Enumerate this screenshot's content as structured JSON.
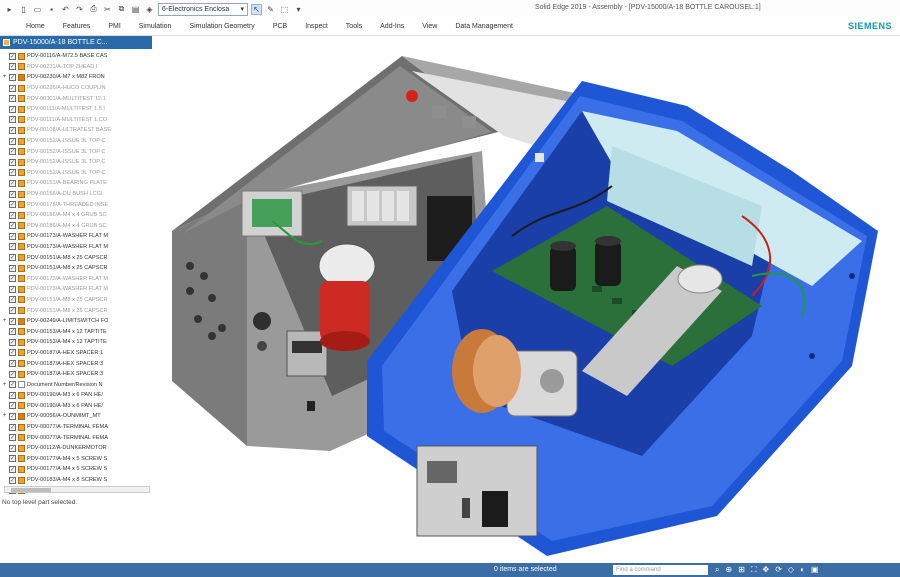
{
  "app": {
    "title": "Solid Edge 2019 - Assembly - [PDV-15000/A-18 BOTTLE CAROUSEL:1]",
    "brand": "SIEMENS",
    "doc_combo": "6-Electronics Enclosa"
  },
  "ribbon": {
    "tabs": [
      "Home",
      "Features",
      "PMI",
      "Simulation",
      "Simulation Geometry",
      "PCB",
      "Inspect",
      "Tools",
      "Add-Ins",
      "View",
      "Data Management"
    ]
  },
  "panel": {
    "title": "PDV-15000/A-18 BOTTLE C..."
  },
  "tree": [
    {
      "label": "PDV-00116/A-M72.5 BASE CAS",
      "dim": false,
      "exp": "",
      "icon": "part"
    },
    {
      "label": "PDV-00231/A-TOP 2HEAD I",
      "dim": true,
      "exp": "",
      "icon": "part"
    },
    {
      "label": "PDV-00230/A-M7 x M82 FRON",
      "dim": false,
      "exp": "+",
      "icon": "asm"
    },
    {
      "label": "PDV-00226/A-HUCO COUPLIN",
      "dim": true,
      "exp": "",
      "icon": "part"
    },
    {
      "label": "PDV-00301/A-MULTITEST 12.1",
      "dim": true,
      "exp": "",
      "icon": "part"
    },
    {
      "label": "PDV-00111/A-MULTITEST 1.5 I",
      "dim": true,
      "exp": "",
      "icon": "part"
    },
    {
      "label": "PDV-00111/A-MULTITEST 1.CO",
      "dim": true,
      "exp": "",
      "icon": "part"
    },
    {
      "label": "PDV-00108/A-ULTRATEST BASE",
      "dim": true,
      "exp": "",
      "icon": "part"
    },
    {
      "label": "PDV-00152/A-ISSUE 3L TOP C",
      "dim": true,
      "exp": "",
      "icon": "part"
    },
    {
      "label": "PDV-00152/A-ISSUE 3L TOP C",
      "dim": true,
      "exp": "",
      "icon": "part"
    },
    {
      "label": "PDV-00152/A-ISSUE 3L TOP C",
      "dim": true,
      "exp": "",
      "icon": "part"
    },
    {
      "label": "PDV-00152/A-ISSUE 3L TOP C",
      "dim": true,
      "exp": "",
      "icon": "part"
    },
    {
      "label": "PDV-00151/A-BEARING PLATE",
      "dim": true,
      "exp": "",
      "icon": "part"
    },
    {
      "label": "PDV-00156/A-DU BUSH LCGI",
      "dim": true,
      "exp": "",
      "icon": "part"
    },
    {
      "label": "PDV-00178/A-THREADED INSE",
      "dim": true,
      "exp": "",
      "icon": "part"
    },
    {
      "label": "PDV-00186/A-M4 x 4 GRUB SC",
      "dim": true,
      "exp": "",
      "icon": "part"
    },
    {
      "label": "PDV-00186/A-M4 x 4 GRUB SC",
      "dim": true,
      "exp": "",
      "icon": "part"
    },
    {
      "label": "PDV-00173/A-WASHER FLAT M",
      "dim": false,
      "exp": "",
      "icon": "part"
    },
    {
      "label": "PDV-00173/A-WASHER FLAT M",
      "dim": false,
      "exp": "",
      "icon": "part"
    },
    {
      "label": "PDV-00151/A-M8 x 25 CAPSCR",
      "dim": false,
      "exp": "",
      "icon": "part"
    },
    {
      "label": "PDV-00151/A-M8 x 25 CAPSCR",
      "dim": false,
      "exp": "",
      "icon": "part"
    },
    {
      "label": "PDV-00173/A-WASHER FLAT M",
      "dim": true,
      "exp": "",
      "icon": "part"
    },
    {
      "label": "PDV-00173/A-WASHER FLAT M",
      "dim": true,
      "exp": "",
      "icon": "part"
    },
    {
      "label": "PDV-00151/A-M8 x 25 CAPSCR",
      "dim": true,
      "exp": "",
      "icon": "part"
    },
    {
      "label": "PDV-00151/A-M8 x 25 CAPSCR",
      "dim": true,
      "exp": "",
      "icon": "part"
    },
    {
      "label": "PDV-00249/A-LIMITSWITCH FO",
      "dim": false,
      "exp": "+",
      "icon": "asm"
    },
    {
      "label": "PDV-00153/A-M4 x 12 TAPTITE",
      "dim": false,
      "exp": "",
      "icon": "part"
    },
    {
      "label": "PDV-00153/A-M4 x 12 TAPTITE",
      "dim": false,
      "exp": "",
      "icon": "part"
    },
    {
      "label": "PDV-00187/A-HEX SPACER:1",
      "dim": false,
      "exp": "",
      "icon": "part"
    },
    {
      "label": "PDV-00187/A-HEX SPACER:3",
      "dim": false,
      "exp": "",
      "icon": "part"
    },
    {
      "label": "PDV-00187/A-HEX SPACER:3",
      "dim": false,
      "exp": "",
      "icon": "part"
    },
    {
      "label": "Document Number/Revision N",
      "dim": false,
      "exp": "+",
      "icon": "doc"
    },
    {
      "label": "PDV-00190/A-M3 x 6 PAN HE/",
      "dim": false,
      "exp": "",
      "icon": "part"
    },
    {
      "label": "PDV-00190/A-M3 x 6 PAN HE/",
      "dim": false,
      "exp": "",
      "icon": "part"
    },
    {
      "label": "PDV-00056/A-OUNMIMT_MT",
      "dim": false,
      "exp": "+",
      "icon": "asm"
    },
    {
      "label": "PDV-00077/A-TERMINAL FEMA",
      "dim": false,
      "exp": "",
      "icon": "part"
    },
    {
      "label": "PDV-00077/A-TERMINAL FEMA",
      "dim": false,
      "exp": "",
      "icon": "part"
    },
    {
      "label": "PDV-00112/A-DUNKERMOTOR",
      "dim": false,
      "exp": "",
      "icon": "part"
    },
    {
      "label": "PDV-00177/A-M4 x 5 SCREW S",
      "dim": false,
      "exp": "",
      "icon": "part"
    },
    {
      "label": "PDV-00177/A-M4 x 5 SCREW S",
      "dim": false,
      "exp": "",
      "icon": "part"
    },
    {
      "label": "PDV-00183/A-M4 x 8 SCREW S",
      "dim": false,
      "exp": "",
      "icon": "part"
    },
    {
      "label": "PDV-00183/A-M4 x 8 SCREW S",
      "dim": false,
      "exp": "",
      "icon": "part"
    }
  ],
  "prompt": "No top level part selected.",
  "status": {
    "message": "0 items are selected",
    "command_placeholder": "Find a command"
  },
  "colors": {
    "accent": "#2b6aa8",
    "status_bar": "#3c6ea6",
    "brand": "#0e9aa7",
    "blue_enclosure": "#1f56d6",
    "gray_enclosure": "#8e8e8e"
  }
}
